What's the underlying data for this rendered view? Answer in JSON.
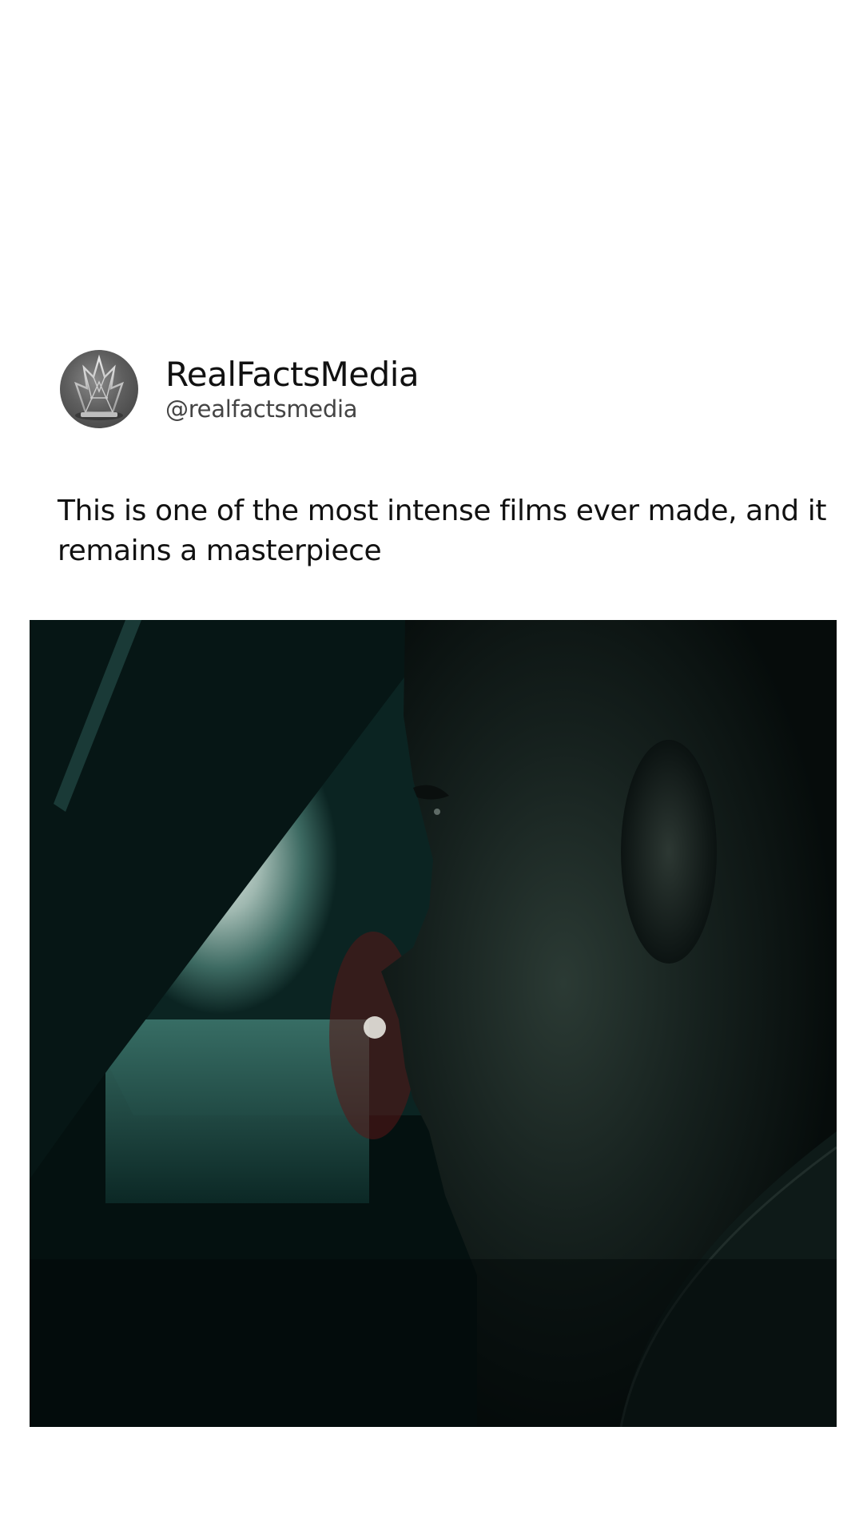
{
  "post": {
    "author": {
      "display_name": "RealFactsMedia",
      "handle": "@realfactsmedia",
      "avatar_icon": "crystal-crown-icon"
    },
    "text": "This is one of the most intense films ever made, and it remains a masterpiece",
    "media": {
      "type": "video-still",
      "icon": "film-still"
    }
  },
  "colors": {
    "background": "#ffffff",
    "text": "#111111",
    "handle": "#444444",
    "media_dark": "#03100f"
  }
}
